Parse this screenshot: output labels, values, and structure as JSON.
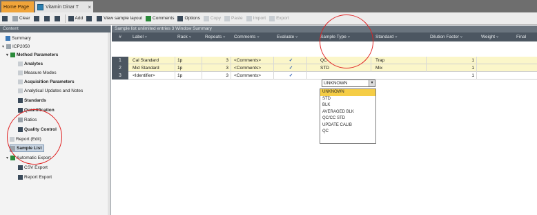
{
  "tabs": [
    {
      "label": "Home Page"
    },
    {
      "label": "Vitamin Dinar T"
    }
  ],
  "toolbar": {
    "items": [
      {
        "label": "Clear"
      },
      {
        "label": "Add"
      },
      {
        "label": "View sample layout"
      },
      {
        "label": "Comments"
      },
      {
        "label": "Options"
      },
      {
        "label": "Copy"
      },
      {
        "label": "Paste"
      },
      {
        "label": "Import"
      },
      {
        "label": "Export"
      }
    ]
  },
  "left_panel": {
    "title": "Content",
    "items": [
      {
        "label": "Summary"
      },
      {
        "label": "ICP2050"
      },
      {
        "label": "Method Parameters"
      },
      {
        "label": "Analytes"
      },
      {
        "label": "Measure Modes"
      },
      {
        "label": "Acquisition Parameters"
      },
      {
        "label": "Analytical Updates and Notes"
      },
      {
        "label": "Standards"
      },
      {
        "label": "Quantification"
      },
      {
        "label": "Ratios"
      },
      {
        "label": "Quality Control"
      },
      {
        "label": "Report (Edit)"
      },
      {
        "label": "Sample List"
      },
      {
        "label": "Automatic Export"
      },
      {
        "label": "CSV Export"
      },
      {
        "label": "Report Export"
      }
    ]
  },
  "grid": {
    "title": "Sample list unlimited entries 3 Window Summary",
    "columns": [
      {
        "label": "#"
      },
      {
        "label": "Label"
      },
      {
        "label": "Rack"
      },
      {
        "label": "Repeats"
      },
      {
        "label": "Comments"
      },
      {
        "label": "Evaluate"
      },
      {
        "label": "Sample Type"
      },
      {
        "label": "Standard"
      },
      {
        "label": "Dilution Factor"
      },
      {
        "label": "Weight"
      },
      {
        "label": "Final"
      }
    ],
    "rows": [
      {
        "num": "1",
        "label": "Cal Standard",
        "rack": "1p",
        "repeats": "3",
        "comments": "<Comments>",
        "evaluate": "✓",
        "sample_type": "QC",
        "standard": "Trap",
        "dilution": "1"
      },
      {
        "num": "2",
        "label": "Mid Standard",
        "rack": "1p",
        "repeats": "3",
        "comments": "<Comments>",
        "evaluate": "✓",
        "sample_type": "STD",
        "standard": "Mix",
        "dilution": "1"
      },
      {
        "num": "3",
        "label": "<Identifier>",
        "rack": "1p",
        "repeats": "3",
        "comments": "<Comments>",
        "evaluate": "✓",
        "sample_type": "UNKNOWN",
        "standard": "",
        "dilution": "1"
      }
    ],
    "editor_value": "UNKNOWN",
    "dropdown_options": [
      {
        "label": "UNKNOWN"
      },
      {
        "label": "STD"
      },
      {
        "label": "BLK"
      },
      {
        "label": "AVERAGED BLK"
      },
      {
        "label": "QC/CC STD"
      },
      {
        "label": "UPDATE CALIB"
      },
      {
        "label": "QC"
      }
    ]
  },
  "colors": {
    "tab_active": "#f0a43a",
    "header_bg": "#4c5661",
    "selected_row": "#fbf6c9",
    "dropdown_highlight": "#f5cd46",
    "annotation_circle": "#e02020"
  }
}
